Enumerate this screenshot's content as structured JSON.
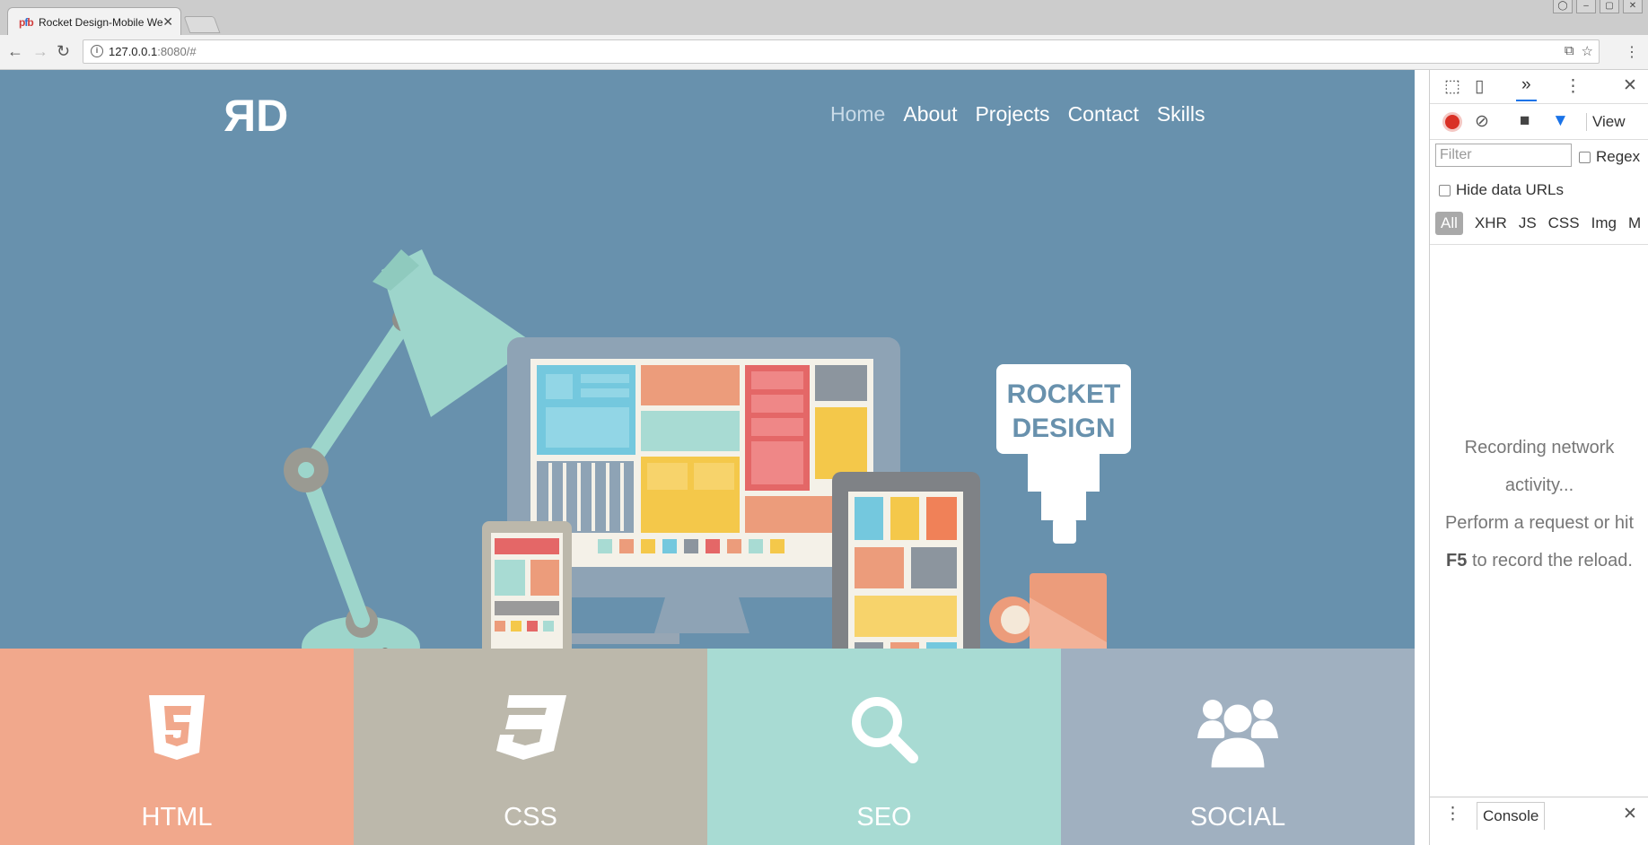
{
  "browser": {
    "tab_title": "Rocket Design-Mobile Web",
    "favicon_text": "pfb",
    "url_host": "127.0.0.1",
    "url_rest": ":8080/#"
  },
  "site": {
    "logo_text": "RD",
    "nav": [
      {
        "label": "Home",
        "active": true
      },
      {
        "label": "About",
        "active": false
      },
      {
        "label": "Projects",
        "active": false
      },
      {
        "label": "Contact",
        "active": false
      },
      {
        "label": "Skills",
        "active": false
      }
    ],
    "sign_line1": "ROCKET",
    "sign_line2": "DESIGN",
    "features": [
      {
        "label": "HTML",
        "color": "#f1a88c",
        "icon": "html5-icon"
      },
      {
        "label": "CSS",
        "color": "#bcb8ab",
        "icon": "css3-icon"
      },
      {
        "label": "SEO",
        "color": "#a8dbd3",
        "icon": "search-icon"
      },
      {
        "label": "SOCIAL",
        "color": "#a0b0c0",
        "icon": "users-icon"
      }
    ],
    "hero_color": "#6891ad"
  },
  "devtools": {
    "filter_placeholder": "Filter",
    "regex_label": "Regex",
    "hide_data_urls_label": "Hide data URLs",
    "type_filters": [
      "All",
      "XHR",
      "JS",
      "CSS",
      "Img",
      "M"
    ],
    "view_label": "View",
    "recording_line1": "Recording network activity...",
    "recording_line2a": "Perform a request or hit",
    "recording_key": "F5",
    "recording_line2b": "to record the reload.",
    "drawer_tab": "Console"
  }
}
